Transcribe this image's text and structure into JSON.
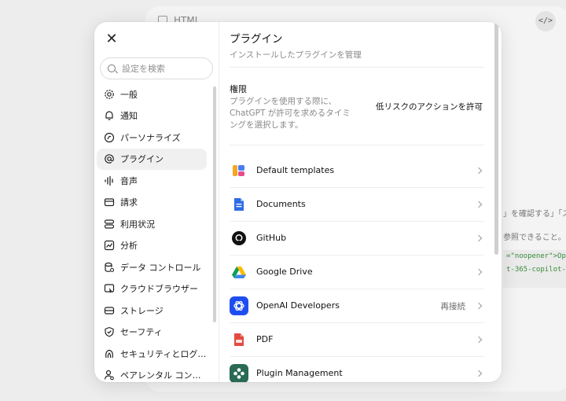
{
  "background": {
    "doc_title": "HTML",
    "code_button": "</>",
    "text_line1": "」を確認する」「スラ",
    "text_line2": "参照できること。",
    "code_line1": "=\"noopener\">Ope",
    "code_line2": "t-365-copilot-"
  },
  "sidebar": {
    "search_placeholder": "設定を検索",
    "items": [
      {
        "label": "一般",
        "icon": "gear-icon"
      },
      {
        "label": "通知",
        "icon": "bell-icon"
      },
      {
        "label": "パーソナライズ",
        "icon": "personalize-icon"
      },
      {
        "label": "プラグイン",
        "icon": "at-icon",
        "active": true
      },
      {
        "label": "音声",
        "icon": "waveform-icon"
      },
      {
        "label": "請求",
        "icon": "card-icon"
      },
      {
        "label": "利用状況",
        "icon": "usage-icon"
      },
      {
        "label": "分析",
        "icon": "chart-icon"
      },
      {
        "label": "データ コントロール",
        "icon": "database-icon"
      },
      {
        "label": "クラウドブラウザー",
        "icon": "browser-icon"
      },
      {
        "label": "ストレージ",
        "icon": "storage-icon"
      },
      {
        "label": "セーフティ",
        "icon": "shield-icon"
      },
      {
        "label": "セキュリティとログ…",
        "icon": "security-icon"
      },
      {
        "label": "ペアレンタル コン…",
        "icon": "parental-icon"
      }
    ]
  },
  "main": {
    "title": "プラグイン",
    "subtitle": "インストールしたプラグインを管理",
    "permission": {
      "title": "権限",
      "description": "プラグインを使用する際に、ChatGPT が許可を求めるタイミングを選択します。",
      "value": "低リスクのアクションを許可"
    },
    "plugins": [
      {
        "name": "Default templates",
        "status": "",
        "icon": "templates-icon"
      },
      {
        "name": "Documents",
        "status": "",
        "icon": "documents-icon"
      },
      {
        "name": "GitHub",
        "status": "",
        "icon": "github-icon"
      },
      {
        "name": "Google Drive",
        "status": "",
        "icon": "google-drive-icon"
      },
      {
        "name": "OpenAI Developers",
        "status": "再接続",
        "icon": "openai-icon"
      },
      {
        "name": "PDF",
        "status": "",
        "icon": "pdf-icon"
      },
      {
        "name": "Plugin Management",
        "status": "",
        "icon": "plugin-management-icon"
      }
    ]
  },
  "colors": {
    "accent_active_bg": "#f0f0f0",
    "openai_blue": "#1f4ef0",
    "pdf_red": "#e24c3f",
    "plugin_mgmt_green": "#2a6a55"
  }
}
